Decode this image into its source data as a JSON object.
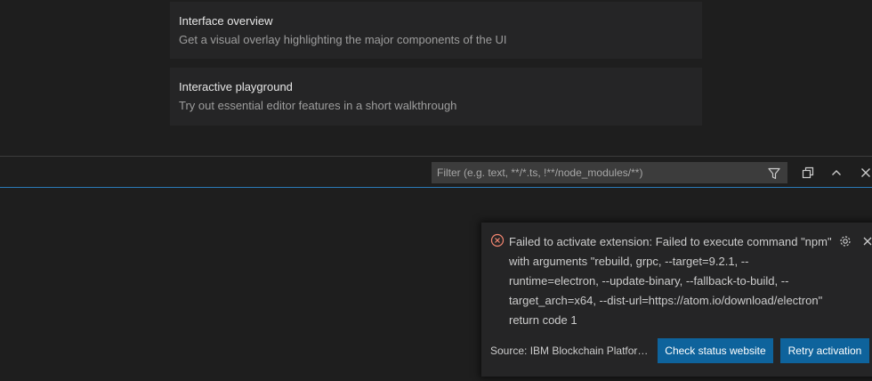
{
  "walkthrough": {
    "cards": [
      {
        "title": "Interface overview",
        "description": "Get a visual overlay highlighting the major components of the UI"
      },
      {
        "title": "Interactive playground",
        "description": "Try out essential editor features in a short walkthrough"
      }
    ]
  },
  "panel": {
    "filter": {
      "placeholder": "Filter (e.g. text, **/*.ts, !**/node_modules/**)",
      "icon": "filter-icon"
    },
    "actions": [
      {
        "name": "restore-panel-icon"
      },
      {
        "name": "chevron-up-icon"
      },
      {
        "name": "close-icon"
      }
    ]
  },
  "notification": {
    "severity": "error",
    "icon": "error-icon",
    "message_lines": [
      "Failed to activate extension: Failed to execute command \"npm\"",
      "with arguments \"rebuild, grpc, --target=9.2.1, --",
      "runtime=electron, --update-binary, --fallback-to-build, --",
      "target_arch=x64, --dist-url=https://atom.io/download/electron\"",
      "return code 1"
    ],
    "source": "Source: IBM Blockchain Platform ...",
    "buttons": {
      "check_status": "Check status website",
      "retry": "Retry activation"
    }
  },
  "colors": {
    "background": "#1e1e1e",
    "card": "#252526",
    "accent": "#0e639c",
    "panel_border": "#2b79b7",
    "error": "#f48771"
  }
}
